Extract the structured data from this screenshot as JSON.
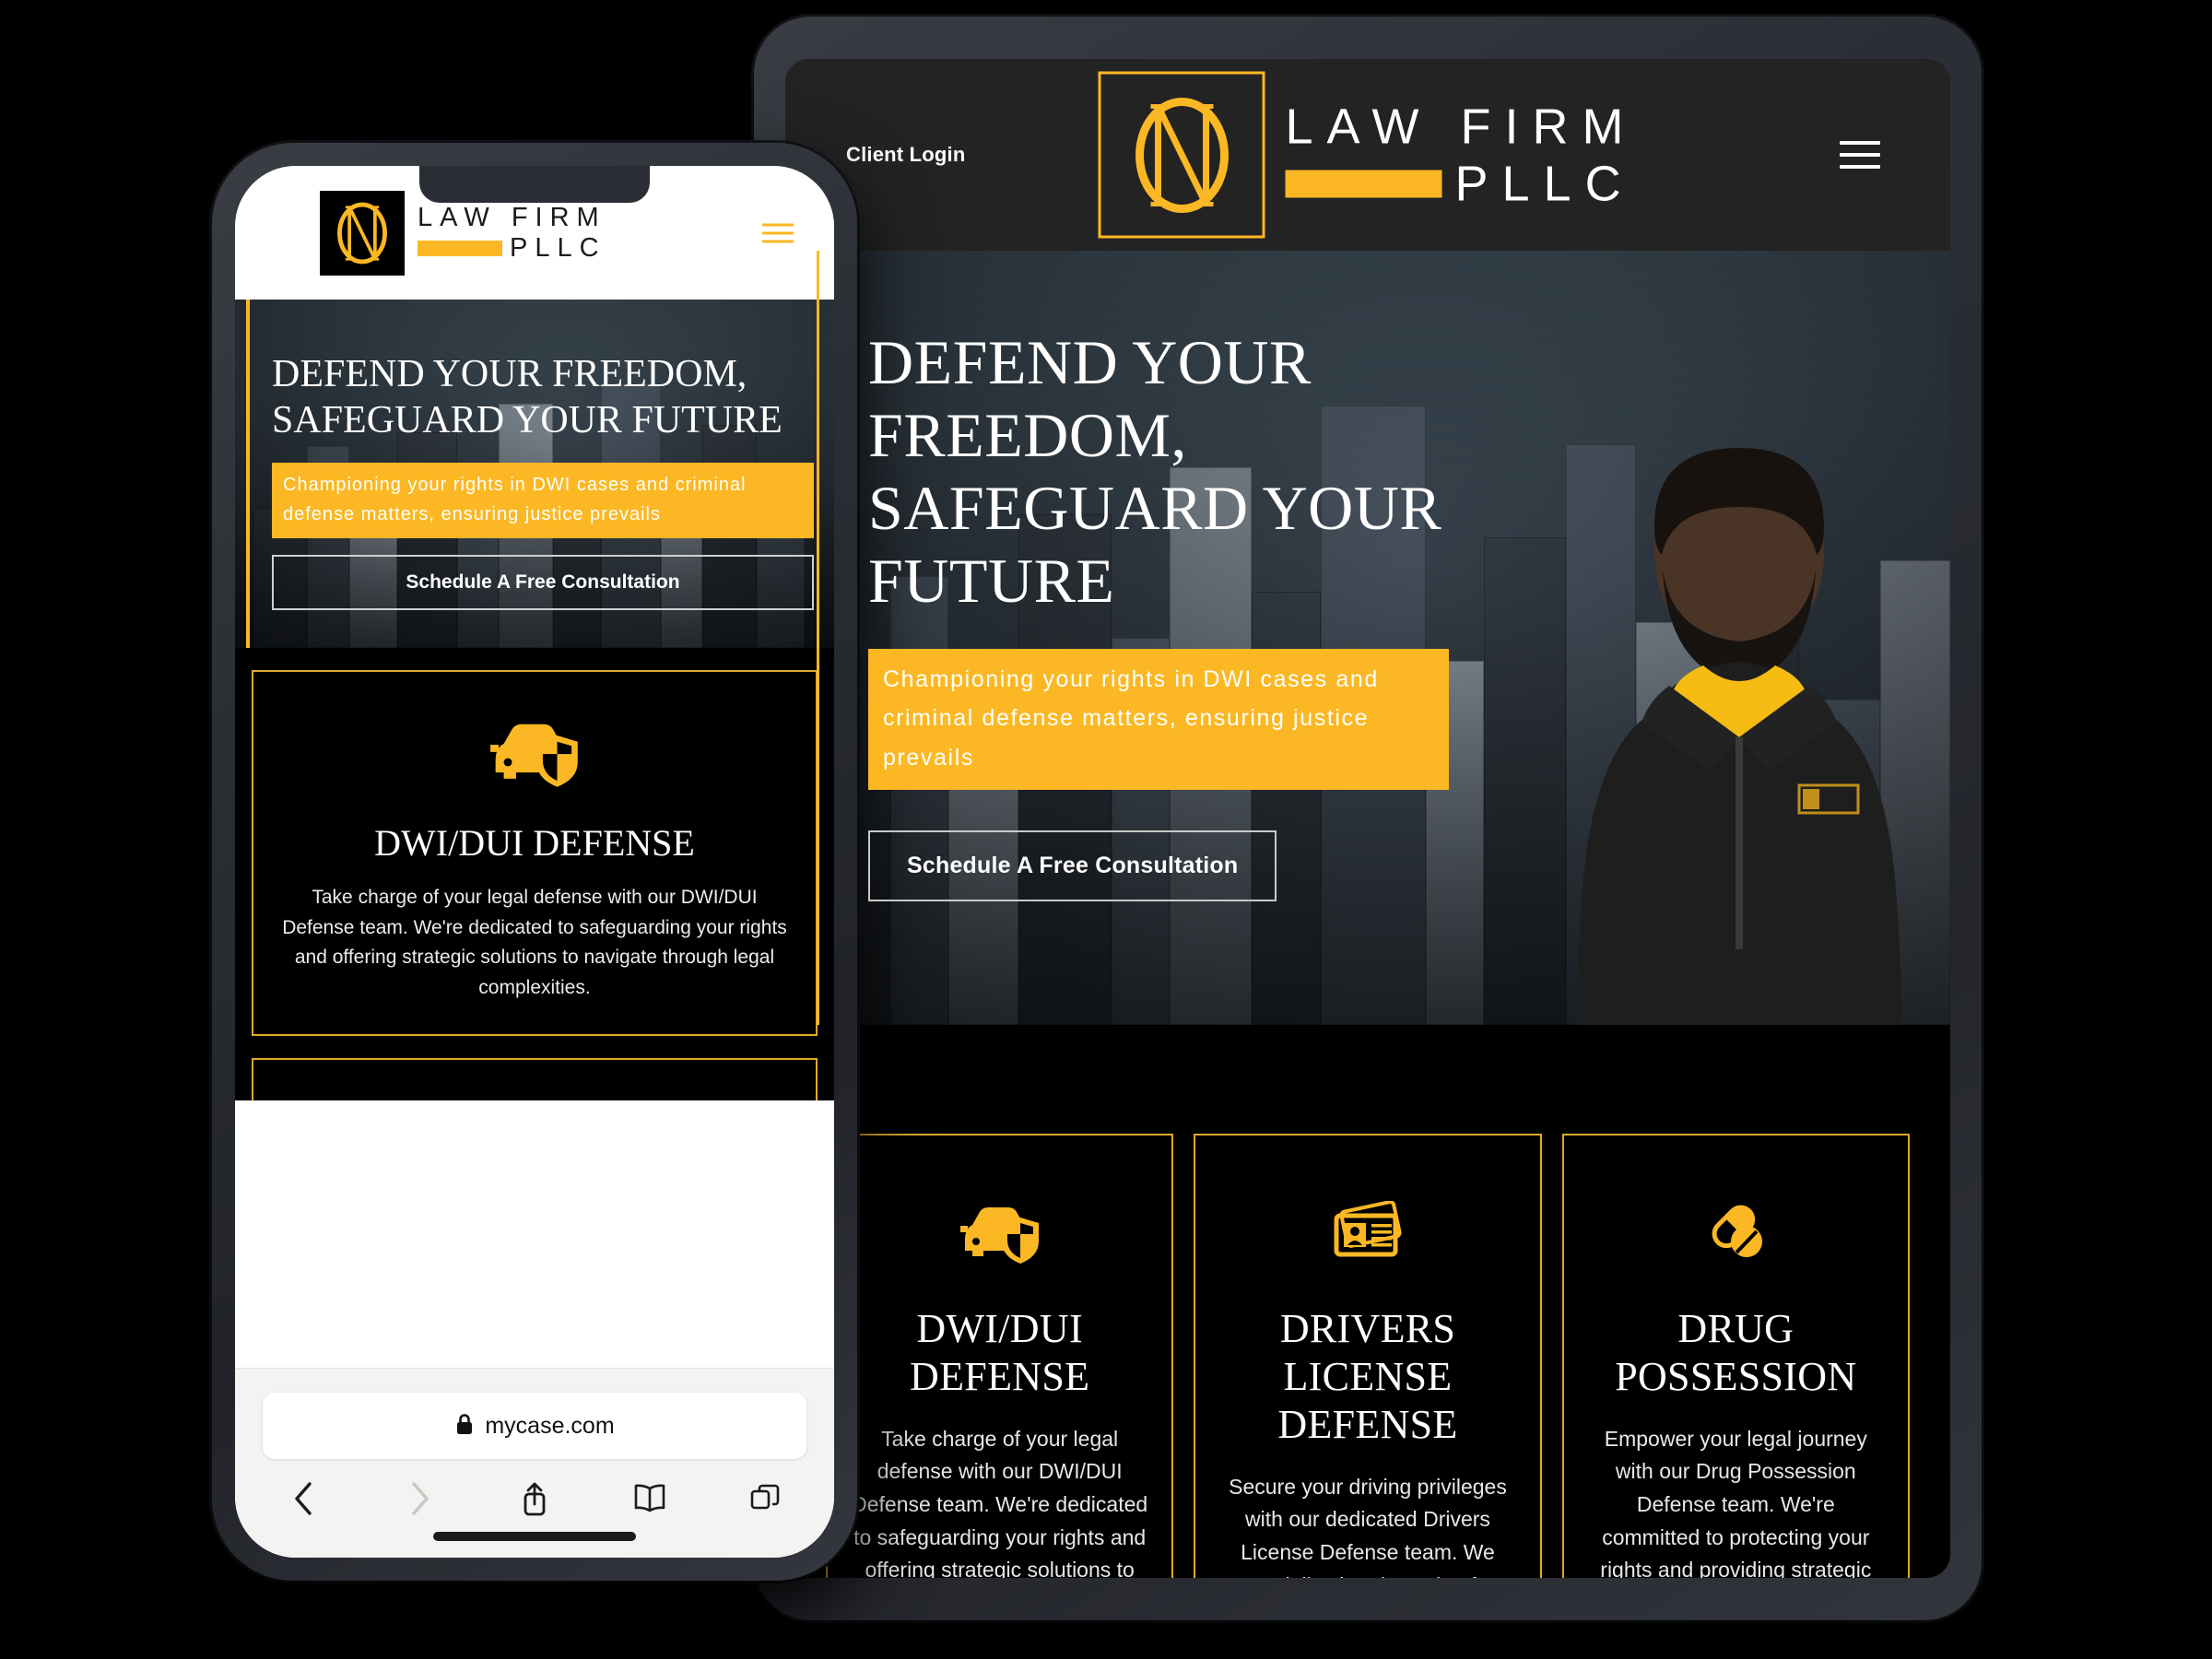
{
  "brand": {
    "accent_yellow": "#fbb824",
    "dark_bg": "#232323",
    "black": "#000000",
    "logo_line1": "LAW FIRM",
    "logo_line2": "PLLC",
    "monogram": "N"
  },
  "tablet": {
    "header": {
      "client_login": "Client Login",
      "menu_icon": "hamburger-menu-icon"
    },
    "hero": {
      "heading": "DEFEND YOUR FREEDOM, SAFEGUARD YOUR FUTURE",
      "subtitle": "Championing your rights in DWI cases and criminal defense matters, ensuring justice prevails",
      "cta": "Schedule A Free Consultation",
      "person_alt": "attorney-portrait"
    },
    "services": [
      {
        "icon": "car-shield-icon",
        "title": "DWI/DUI DEFENSE",
        "body": "Take charge of your legal defense with our DWI/DUI Defense team. We're dedicated to safeguarding your rights and offering strategic solutions to navigate through legal complexities."
      },
      {
        "icon": "id-card-icon",
        "title": "DRIVERS LICENSE DEFENSE",
        "body": "Secure your driving privileges with our dedicated Drivers License Defense team. We specialize in advocating for your rights and"
      },
      {
        "icon": "pills-icon",
        "title": "DRUG POSSESSION",
        "body": "Empower your legal journey with our Drug Possession Defense team. We're committed to protecting your rights and providing strategic solutions to overcome legal hurdles."
      }
    ]
  },
  "phone": {
    "header": {
      "menu_icon": "hamburger-menu-icon"
    },
    "hero": {
      "heading": "DEFEND YOUR FREEDOM, SAFEGUARD YOUR FUTURE",
      "subtitle": "Championing your rights in DWI cases and criminal defense matters, ensuring justice prevails",
      "cta": "Schedule A Free Consultation"
    },
    "services": [
      {
        "icon": "car-shield-icon",
        "title": "DWI/DUI DEFENSE",
        "body": "Take charge of your legal defense with our DWI/DUI Defense team. We're dedicated to safeguarding your rights and offering strategic solutions to navigate through legal complexities."
      }
    ],
    "browser": {
      "url": "mycase.com",
      "lock_icon": "lock-icon",
      "back_icon": "chevron-left-icon",
      "forward_icon": "chevron-right-icon",
      "share_icon": "share-icon",
      "bookmarks_icon": "book-icon",
      "tabs_icon": "tabs-icon"
    }
  }
}
